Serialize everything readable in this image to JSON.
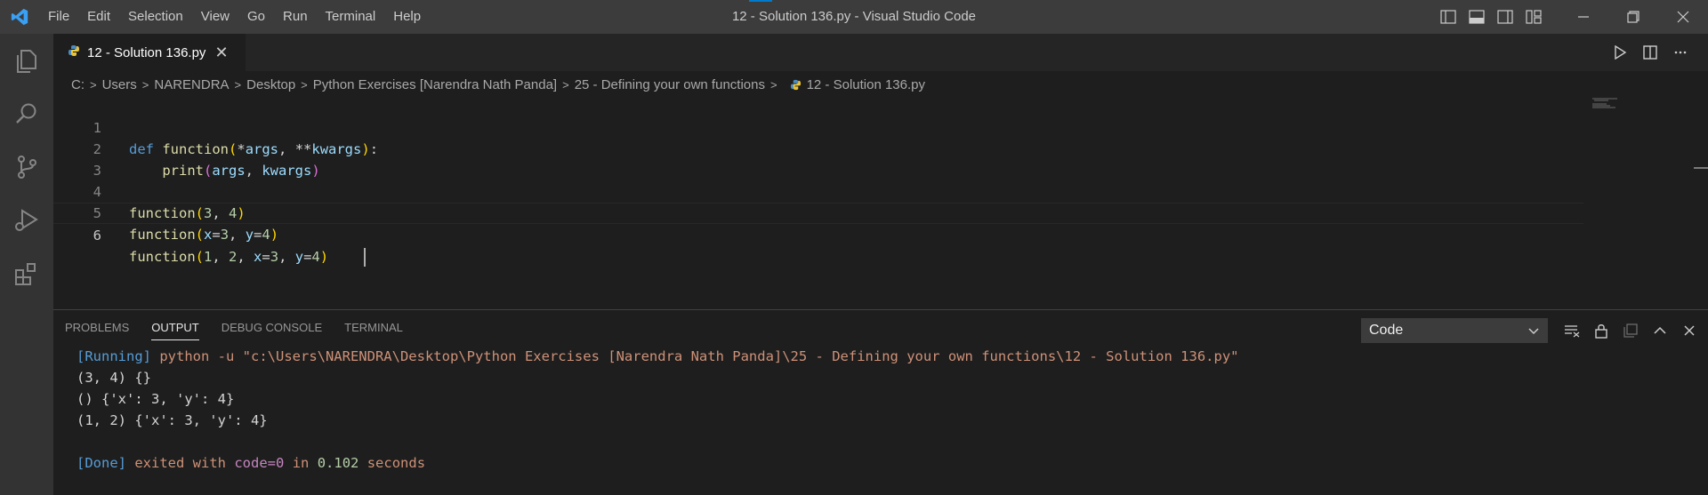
{
  "titlebar": {
    "menu": [
      "File",
      "Edit",
      "Selection",
      "View",
      "Go",
      "Run",
      "Terminal",
      "Help"
    ],
    "title": "12 - Solution 136.py - Visual Studio Code",
    "layout_icons": [
      "toggle-primary-sidebar-icon",
      "toggle-panel-icon",
      "toggle-secondary-sidebar-icon",
      "customize-layout-icon"
    ],
    "window_icons": [
      "minimize-icon",
      "restore-icon",
      "close-icon"
    ]
  },
  "activitybar": {
    "icons": [
      "explorer-icon",
      "search-icon",
      "source-control-icon",
      "run-debug-icon",
      "extensions-icon"
    ]
  },
  "tab": {
    "label": "12 - Solution 136.py",
    "close": "✕"
  },
  "editor_actions": [
    "run-icon",
    "split-editor-icon",
    "more-actions-icon"
  ],
  "breadcrumb": [
    "C:",
    "Users",
    "NARENDRA",
    "Desktop",
    "Python Exercises [Narendra Nath Panda]",
    "25 - Defining your own functions",
    "12 - Solution 136.py"
  ],
  "code": {
    "line_numbers": [
      "1",
      "2",
      "3",
      "4",
      "5",
      "6"
    ],
    "l1": {
      "kw": "def",
      "fn": "function",
      "open": "(",
      "star1": "*",
      "p1": "args",
      "comma": ", ",
      "star2": "**",
      "p2": "kwargs",
      "close": ")",
      "colon": ":"
    },
    "l2": {
      "indent": "    ",
      "fn": "print",
      "open": "(",
      "a1": "args",
      "comma": ", ",
      "a2": "kwargs",
      "close": ")"
    },
    "l4": {
      "fn": "function",
      "open": "(",
      "n1": "3",
      "comma": ", ",
      "n2": "4",
      "close": ")"
    },
    "l5": {
      "fn": "function",
      "open": "(",
      "k1": "x",
      "eq1": "=",
      "n1": "3",
      "comma": ", ",
      "k2": "y",
      "eq2": "=",
      "n2": "4",
      "close": ")"
    },
    "l6": {
      "fn": "function",
      "open": "(",
      "n1": "1",
      "c1": ", ",
      "n2": "2",
      "c2": ", ",
      "k1": "x",
      "eq1": "=",
      "n3": "3",
      "c3": ", ",
      "k2": "y",
      "eq2": "=",
      "n4": "4",
      "close": ")"
    }
  },
  "panel": {
    "tabs": [
      "PROBLEMS",
      "OUTPUT",
      "DEBUG CONSOLE",
      "TERMINAL"
    ],
    "active_tab": "OUTPUT",
    "output_channel": "Code",
    "action_icons": [
      "clear-output-icon",
      "lock-scroll-icon",
      "open-log-icon",
      "maximize-panel-icon",
      "close-panel-icon"
    ]
  },
  "output": {
    "running_tag": "[Running]",
    "running_cmd": "python -u \"c:\\Users\\NARENDRA\\Desktop\\Python Exercises [Narendra Nath Panda]\\25 - Defining your own functions\\12 - Solution 136.py\"",
    "lines": [
      "(3, 4) {}",
      "() {'x': 3, 'y': 4}",
      "(1, 2) {'x': 3, 'y': 4}"
    ],
    "done_tag": "[Done]",
    "done_text1": "exited with",
    "done_code": "code=0",
    "done_text2": "in",
    "done_secs": "0.102",
    "done_text3": "seconds"
  },
  "colors": {
    "accent": "#007acc",
    "keyword": "#569cd6",
    "function": "#dcdcaa",
    "parameter": "#9cdcfe",
    "number": "#b5cea8",
    "bracket": "#ffd700",
    "string": "#ce9178"
  }
}
